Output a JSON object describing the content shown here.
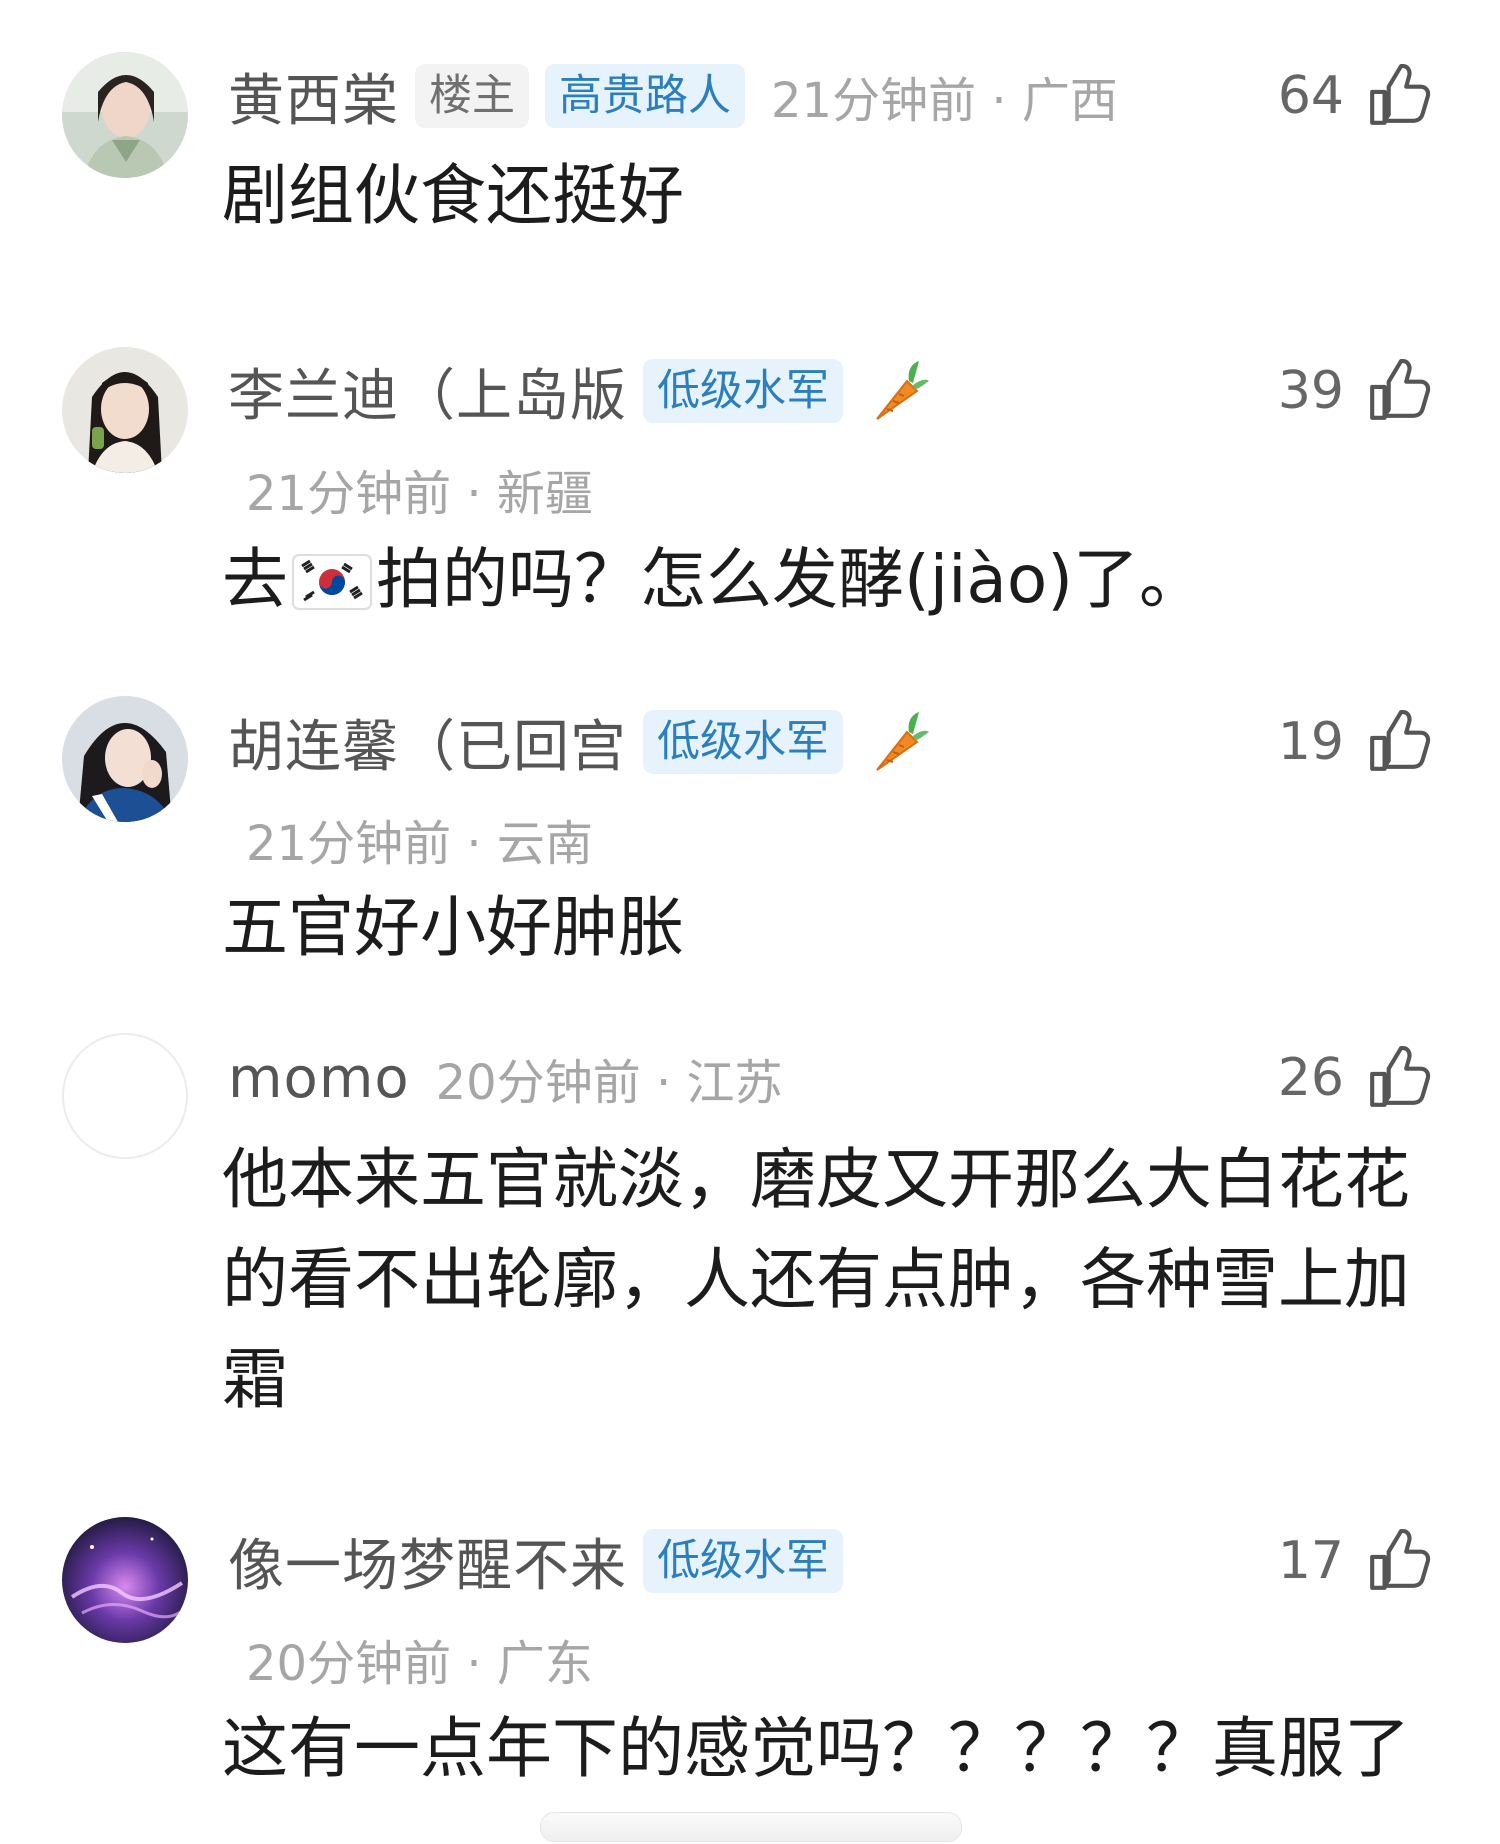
{
  "comments": [
    {
      "username": "黄西棠",
      "badges": [
        "楼主",
        "高贵路人"
      ],
      "time_location": "21分钟前 · 广西",
      "likes": "64",
      "text": "剧组伙食还挺好"
    },
    {
      "username": "李兰迪（上岛版",
      "badges": [
        "低级水军"
      ],
      "time_location": "21分钟前 · 新疆",
      "likes": "39",
      "text_before_flag": "去",
      "flag_icon": "south-korea-flag-icon",
      "text_after_flag": "拍的吗？怎么发酵(jiào)了。"
    },
    {
      "username": "胡连馨（已回宫",
      "badges": [
        "低级水军"
      ],
      "time_location": "21分钟前 · 云南",
      "likes": "19",
      "text": "五官好小好肿胀"
    },
    {
      "username": "momo",
      "badges": [],
      "time_location": "20分钟前 · 江苏",
      "likes": "26",
      "text": "他本来五官就淡，磨皮又开那么大白花花的看不出轮廓，人还有点肿，各种雪上加霜"
    },
    {
      "username": "像一场梦醒不来",
      "badges": [
        "低级水军"
      ],
      "time_location": "20分钟前 · 广东",
      "likes": "17",
      "text": "这有一点年下的感觉吗？？？？？真服了"
    }
  ],
  "icons": {
    "like": "thumbs-up-outline-icon",
    "carrot": "carrot-icon"
  },
  "colors": {
    "badge_blue_bg": "#e6f3fc",
    "badge_blue_text": "#2c7fbd",
    "badge_gray_bg": "#f3f3f3",
    "meta_gray": "#a6a6a6"
  }
}
